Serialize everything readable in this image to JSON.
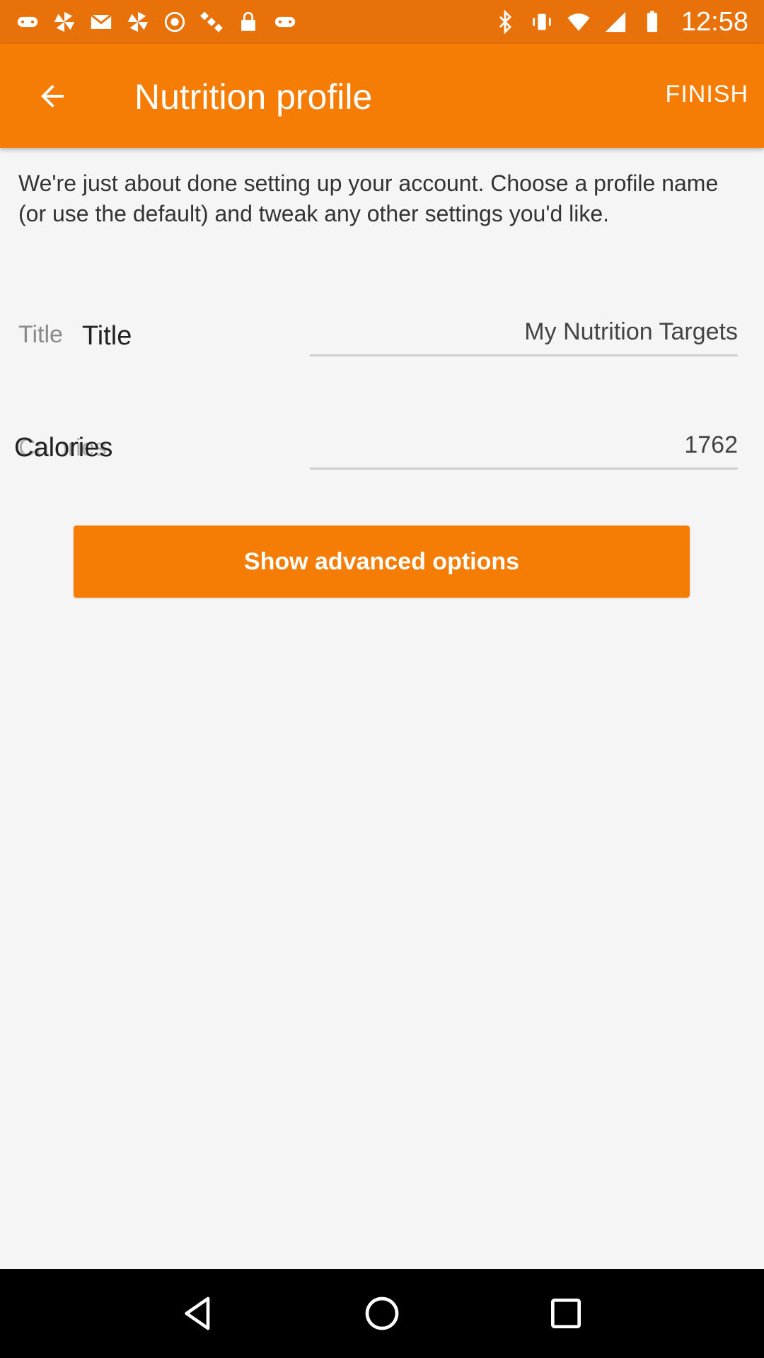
{
  "status_bar": {
    "time": "12:58",
    "left_icons": [
      "gamepad-icon",
      "pinwheel-icon",
      "mail-icon",
      "pinwheel-icon",
      "record-icon",
      "satellite-icon",
      "lock-icon",
      "gamepad-icon"
    ],
    "right_icons": [
      "bluetooth-icon",
      "vibrate-icon",
      "wifi-icon",
      "signal-icon",
      "battery-icon"
    ]
  },
  "app_bar": {
    "title": "Nutrition profile",
    "finish_label": "FINISH",
    "color": "#f57c05"
  },
  "intro_text": "We're just about done setting up your account. Choose a profile name (or use the default) and tweak any other settings you'd like.",
  "fields": {
    "title": {
      "floating_label": "Title",
      "label": "Title",
      "value": "My Nutrition Targets"
    },
    "calories": {
      "floating_label": "Calories",
      "label": "Calories",
      "value": "1762"
    }
  },
  "advanced_button": {
    "label": "Show advanced options"
  },
  "nav_bar": {
    "buttons": [
      "back-triangle-icon",
      "home-circle-icon",
      "recents-square-icon"
    ]
  }
}
